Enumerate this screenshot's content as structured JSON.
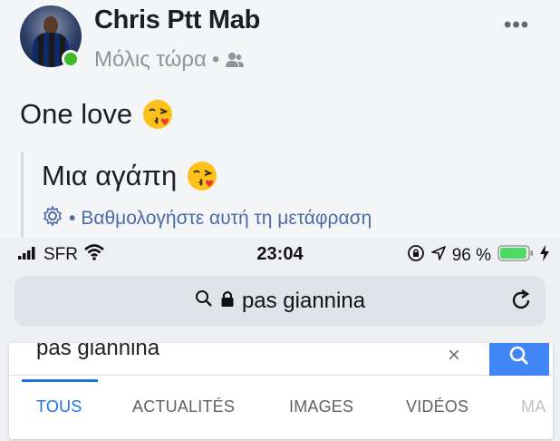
{
  "post": {
    "author": "Chris Ptt Mab",
    "timestamp": "Μόλις τώρα",
    "separator": "•",
    "audience_icon": "friends-icon",
    "more_icon": "more-horizontal-icon",
    "more_label": "•••",
    "text": "One love",
    "text_emoji": "face-blowing-kiss",
    "translation": {
      "text": "Μια αγάπη",
      "text_emoji": "face-blowing-kiss",
      "rate_label": "Βαθμολογήστε αυτή τη μετάφραση",
      "rate_separator": "•",
      "icon": "gear-icon"
    },
    "online_color": "#42b72a"
  },
  "status_bar": {
    "carrier": "SFR",
    "time": "23:04",
    "battery": "96 %",
    "battery_level": 0.96,
    "battery_color": "#4cd964",
    "icons": [
      "signal-icon",
      "wifi-icon",
      "lock-rotation-icon",
      "location-icon",
      "battery-icon",
      "charging-icon"
    ]
  },
  "safari": {
    "address": "pas giannina",
    "icons": [
      "search-icon",
      "lock-icon",
      "reload-icon"
    ]
  },
  "google": {
    "query": "pas giannina",
    "clear_label": "×",
    "tabs": [
      {
        "label": "TOUS",
        "active": true
      },
      {
        "label": "ACTUALITÉS",
        "active": false
      },
      {
        "label": "IMAGES",
        "active": false
      },
      {
        "label": "VIDÉOS",
        "active": false
      },
      {
        "label": "MA",
        "active": false
      }
    ],
    "accent": "#4285f4",
    "active_tab_color": "#1a73e8"
  }
}
